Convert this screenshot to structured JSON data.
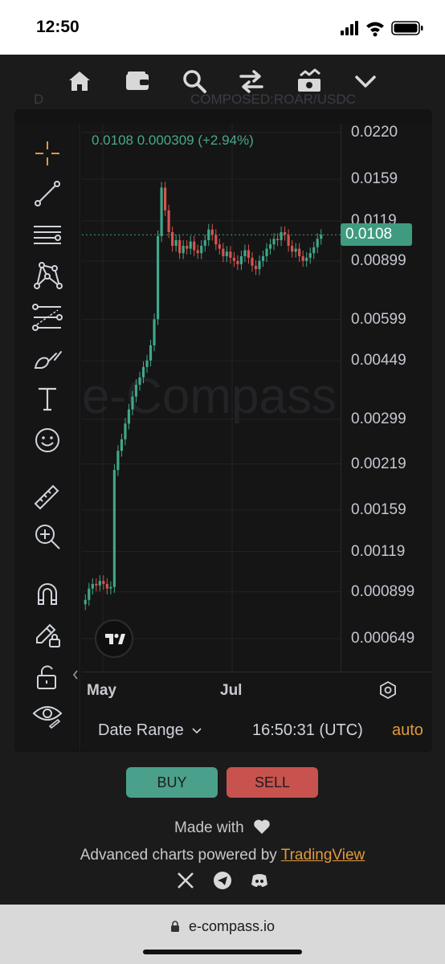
{
  "status_bar": {
    "time": "12:50"
  },
  "nav": {
    "icons": [
      "home-icon",
      "wallet-icon",
      "search-icon",
      "swap-icon",
      "money-icon",
      "chevron-down-icon"
    ]
  },
  "ghost_header": {
    "interval": "D",
    "symbol": "COMPOSED:ROAR/USDC"
  },
  "chart": {
    "ohlc_text": "0.0108  0.000309 (+2.94%)",
    "watermark": "e-Compass",
    "current_price": "0.0108",
    "price_labels": [
      "0.0220",
      "0.0159",
      "0.0119",
      "0.00899",
      "0.00599",
      "0.00449",
      "0.00299",
      "0.00219",
      "0.00159",
      "0.00119",
      "0.000899",
      "0.000649"
    ],
    "time_labels": [
      "May",
      "Jul"
    ],
    "bottom": {
      "date_range": "Date Range",
      "clock": "16:50:31 (UTC)",
      "auto": "auto"
    }
  },
  "toolbar": {
    "tools": [
      "crosshair-icon",
      "trend-line-icon",
      "horizontal-lines-icon",
      "pattern-icon",
      "fib-icon",
      "brush-icon",
      "text-tool-icon",
      "emoji-icon",
      "ruler-icon",
      "zoom-in-icon",
      "magnet-icon",
      "lock-drawing-icon",
      "unlock-icon",
      "eye-icon"
    ],
    "accent": "#e09a3c"
  },
  "actions": {
    "buy": "BUY",
    "sell": "SELL"
  },
  "footer": {
    "made_with": "Made with",
    "powered_prefix": "Advanced charts powered by ",
    "powered_link": "TradingView",
    "socials": [
      "x-icon",
      "telegram-icon",
      "discord-icon"
    ]
  },
  "browser": {
    "url": "e-compass.io"
  },
  "colors": {
    "up": "#3fa88a",
    "down": "#d8534f",
    "accent": "#e09a3c",
    "price_tag": "#3f9b80"
  },
  "chart_data": {
    "type": "candlestick",
    "title": "",
    "y_scale": "log",
    "ylim": [
      0.000649,
      0.022
    ],
    "x_ticks": [
      "May",
      "Jul"
    ],
    "current_price": 0.0108,
    "change": 0.000309,
    "change_pct": 2.94,
    "closes": [
      0.00085,
      0.00092,
      0.00095,
      0.00094,
      0.00097,
      0.00095,
      0.00092,
      0.00093,
      0.0021,
      0.0024,
      0.0026,
      0.0029,
      0.0032,
      0.0035,
      0.0038,
      0.004,
      0.0043,
      0.0045,
      0.005,
      0.006,
      0.0107,
      0.015,
      0.0128,
      0.011,
      0.01,
      0.0104,
      0.0095,
      0.01,
      0.0098,
      0.0103,
      0.0097,
      0.0095,
      0.01,
      0.0104,
      0.0112,
      0.0108,
      0.0101,
      0.0098,
      0.0093,
      0.0096,
      0.0092,
      0.009,
      0.0088,
      0.0093,
      0.0097,
      0.0092,
      0.0087,
      0.0085,
      0.009,
      0.0093,
      0.0098,
      0.0101,
      0.0105,
      0.0104,
      0.011,
      0.0108,
      0.01,
      0.0096,
      0.0098,
      0.0093,
      0.009,
      0.0092,
      0.0095,
      0.0099,
      0.0105,
      0.0108
    ]
  }
}
